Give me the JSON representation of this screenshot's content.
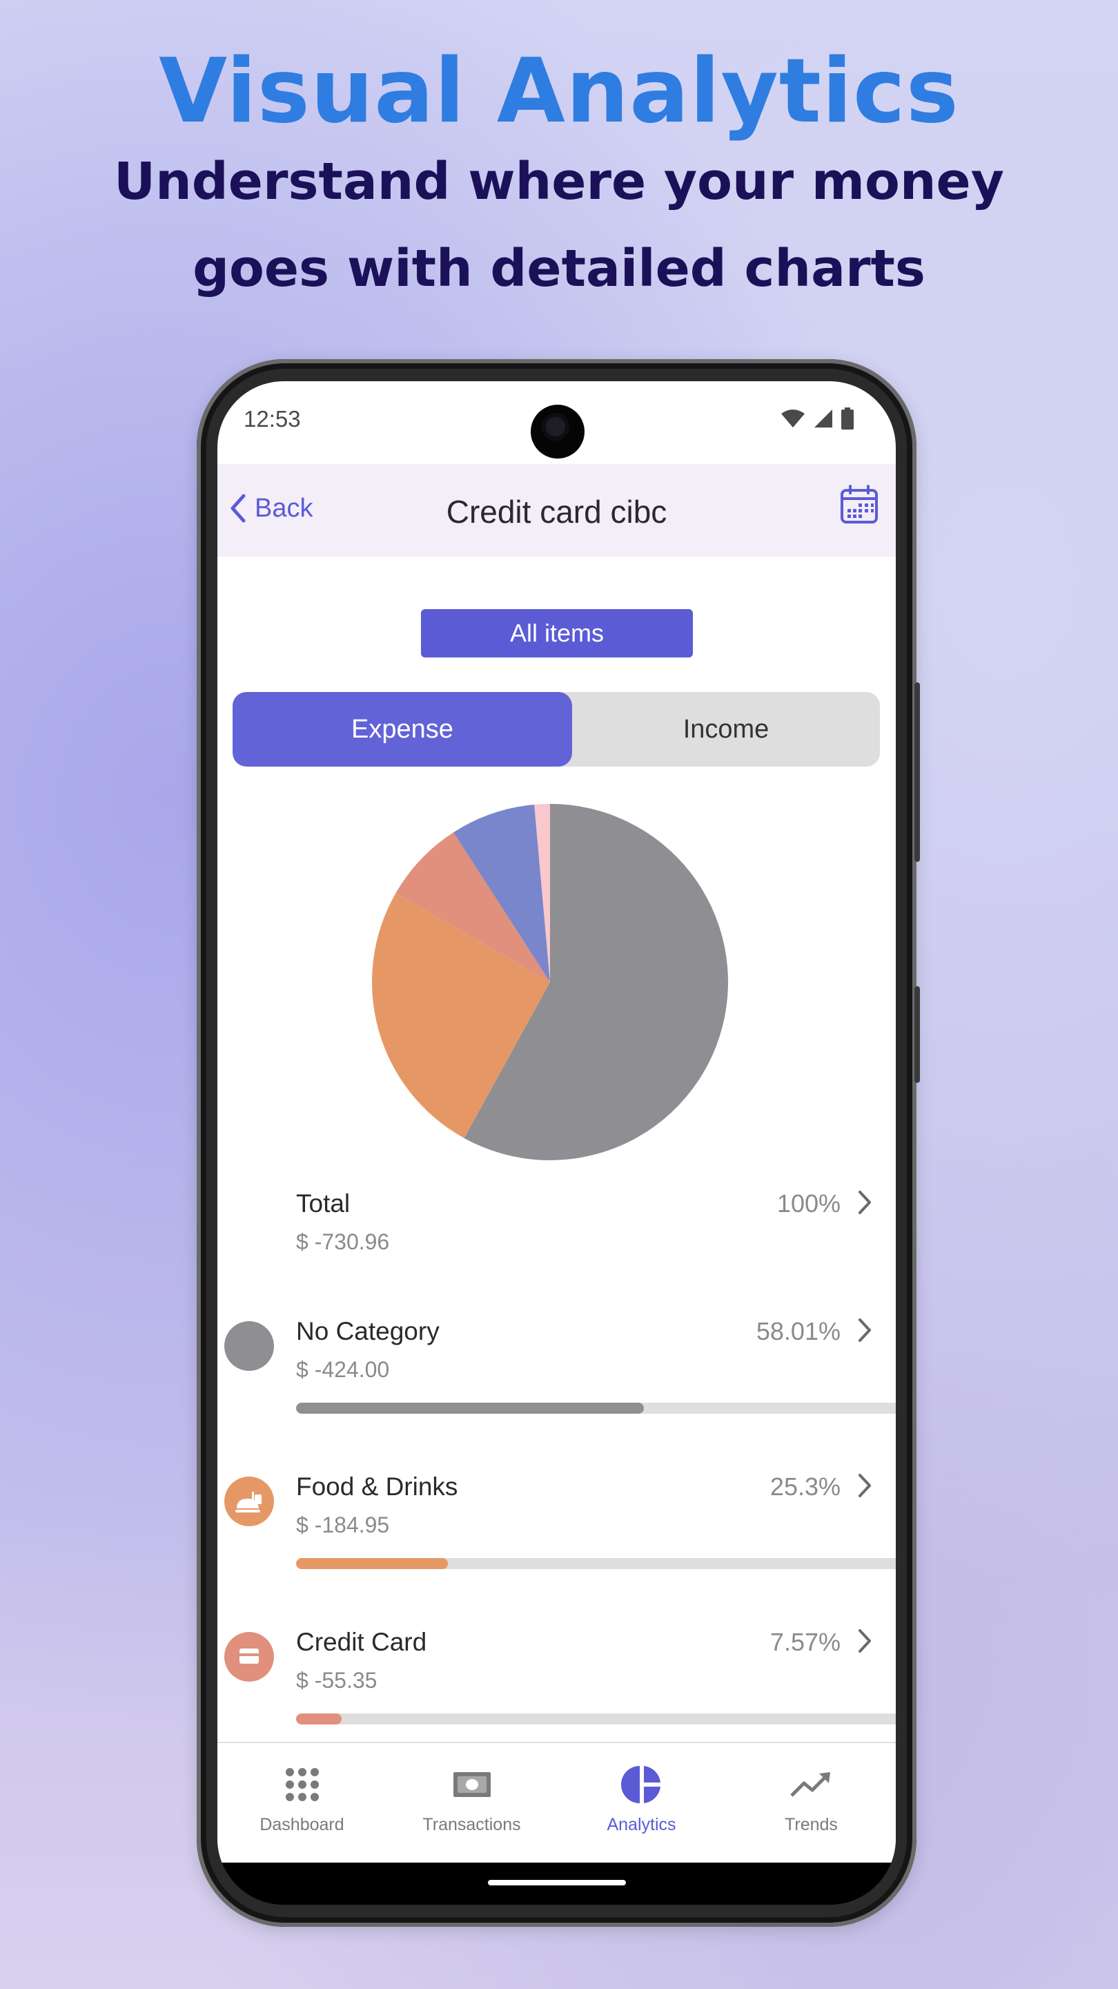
{
  "headline": "Visual Analytics",
  "subheadline": "Understand where your money goes with detailed charts",
  "status_bar": {
    "time": "12:53"
  },
  "header": {
    "back_label": "Back",
    "title": "Credit card cibc"
  },
  "filter": {
    "label": "All items"
  },
  "tabs": {
    "expense": "Expense",
    "income": "Income",
    "active": "Expense"
  },
  "chart_data": {
    "type": "pie",
    "slices": [
      {
        "label": "No Category",
        "percent": 58.01,
        "color": "#8e8e93"
      },
      {
        "label": "Food & Drinks",
        "percent": 25.3,
        "color": "#e59866"
      },
      {
        "label": "Credit Card",
        "percent": 7.57,
        "color": "#e0907c"
      },
      {
        "label": "",
        "percent": 7.71,
        "color": "#7986cb"
      },
      {
        "label": "",
        "percent": 1.41,
        "color": "#f8c8cc"
      }
    ]
  },
  "summary": {
    "total": {
      "name": "Total",
      "amount": "$ -730.96",
      "percent": "100%"
    },
    "categories": [
      {
        "name": "No Category",
        "amount": "$ -424.00",
        "percent": "58.01%",
        "share": 0.5801,
        "color": "#8e8e93",
        "icon": "blank-circle-icon"
      },
      {
        "name": "Food & Drinks",
        "amount": "$ -184.95",
        "percent": "25.3%",
        "share": 0.253,
        "color": "#e59866",
        "icon": "food-drinks-icon"
      },
      {
        "name": "Credit Card",
        "amount": "$ -55.35",
        "percent": "7.57%",
        "share": 0.0757,
        "color": "#e0907c",
        "icon": "credit-card-icon"
      }
    ]
  },
  "bottom_nav": {
    "items": [
      {
        "label": "Dashboard",
        "icon": "grid-dots-icon"
      },
      {
        "label": "Transactions",
        "icon": "banknote-icon"
      },
      {
        "label": "Analytics",
        "icon": "pie-chart-icon"
      },
      {
        "label": "Trends",
        "icon": "trend-up-icon"
      }
    ],
    "active": "Analytics"
  },
  "colors": {
    "accent": "#5b5bd6",
    "headline": "#2f7de0",
    "subheadline": "#1b1158"
  }
}
